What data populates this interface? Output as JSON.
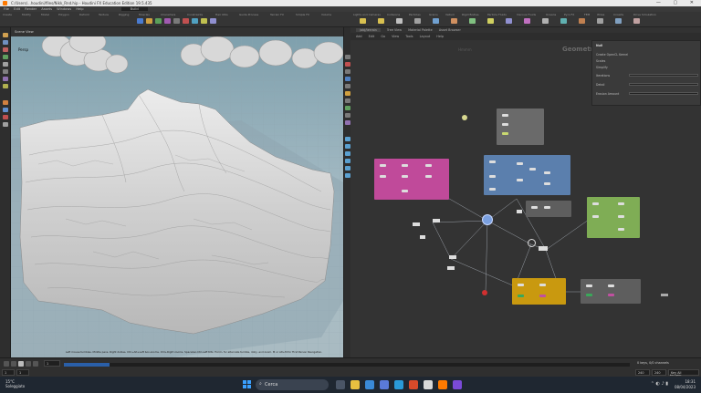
{
  "window": {
    "title": "C:/Users/...houdini/files/Nikk_Rnd.hip - Houdini FX Education Edition 19.5.435",
    "controls": "—  ▢  ✕"
  },
  "menubar": [
    "File",
    "Edit",
    "Render",
    "Assets",
    "Windows",
    "Help",
    "Build"
  ],
  "shelf_left": {
    "tabs": [
      "Create",
      "Modify",
      "Model",
      "Polygon",
      "Deform",
      "Texture",
      "Rigging",
      "Muscles",
      "Characters",
      "Constraints",
      "Hair Utils",
      "Guide Process",
      "Terrain FX",
      "Simple FX",
      "Volume"
    ]
  },
  "shelf_right": {
    "tabs": [
      "Lights and Cameras",
      "Collisions",
      "Particles",
      "Grains",
      "Vellum",
      "Rigid Bodies",
      "Particle Fluids",
      "Viscous Fluids",
      "Oceans",
      "Pyro FX",
      "FEM",
      "Wires",
      "Crowds",
      "Drive Simulation"
    ]
  },
  "viewport": {
    "tab": "Scene View",
    "camera_label": "Persp",
    "help_text": "Left mouse tumbles. Middle pans. Right dollies. Ctrl+Alt+Left box-zooms. Ctrl+Right zooms. Spacebar-Ctrl-Left tilts. Hold L for alternate tumble, dolly, and zoom.   M or Alt+M for First Person Navigation."
  },
  "network": {
    "path_tabs": [
      "/obj/terrain",
      "Tree View",
      "Material Palette",
      "Asset Browser"
    ],
    "menu": [
      "Add",
      "Edit",
      "Go",
      "View",
      "Tools",
      "Layout",
      "Help"
    ],
    "context_label": "Geometry",
    "object_label": "Hmmm"
  },
  "params": {
    "title": "Null",
    "rows": [
      "Create OpenCL Kernel",
      "Scales",
      "Simplify",
      "Iterations",
      "Detail",
      "Erosion Amount"
    ]
  },
  "timeline": {
    "frame": "1",
    "start": "1",
    "end": "240",
    "end2": "240",
    "keys_label": "0 keys, 0/0 channels",
    "key_all": "Key All Channels",
    "auto_update": "Auto Update"
  },
  "taskbar": {
    "weather_temp": "15°C",
    "weather_desc": "Soleggiato",
    "search_placeholder": "Cerca",
    "time": "18:31",
    "date": "08/04/2023"
  },
  "colors": {
    "pink_box": "#c04a9a",
    "blue_box": "#5b7fad",
    "green_box": "#7fad55",
    "orange_box": "#c9990f",
    "gray_box": "#5e5e5e"
  }
}
